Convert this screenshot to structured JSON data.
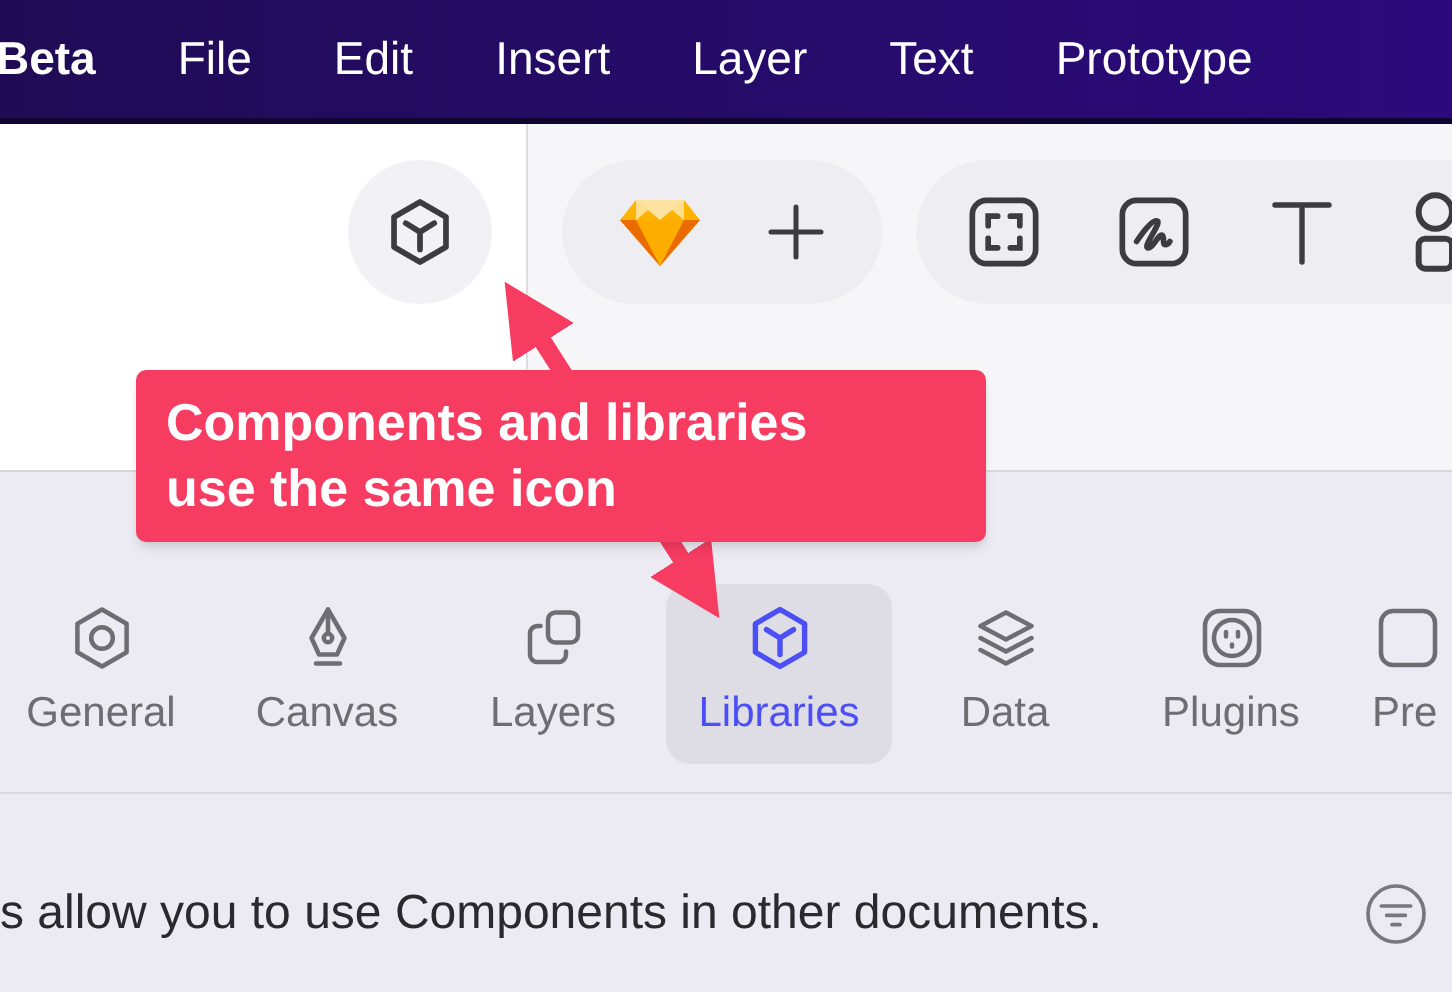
{
  "menu_bar": {
    "items": [
      {
        "label": "Beta",
        "bold": true
      },
      {
        "label": "File",
        "bold": false
      },
      {
        "label": "Edit",
        "bold": false
      },
      {
        "label": "Insert",
        "bold": false
      },
      {
        "label": "Layer",
        "bold": false
      },
      {
        "label": "Text",
        "bold": false
      },
      {
        "label": "Prototype",
        "bold": false
      }
    ]
  },
  "settings": {
    "tabs": [
      {
        "label": "General",
        "selected": false
      },
      {
        "label": "Canvas",
        "selected": false
      },
      {
        "label": "Layers",
        "selected": false
      },
      {
        "label": "Libraries",
        "selected": true
      },
      {
        "label": "Data",
        "selected": false
      },
      {
        "label": "Plugins",
        "selected": false
      },
      {
        "label": "Pre",
        "selected": false
      }
    ],
    "description": "s allow you to use Components in other documents."
  },
  "callout": {
    "text": "Components and libraries use the same icon"
  }
}
